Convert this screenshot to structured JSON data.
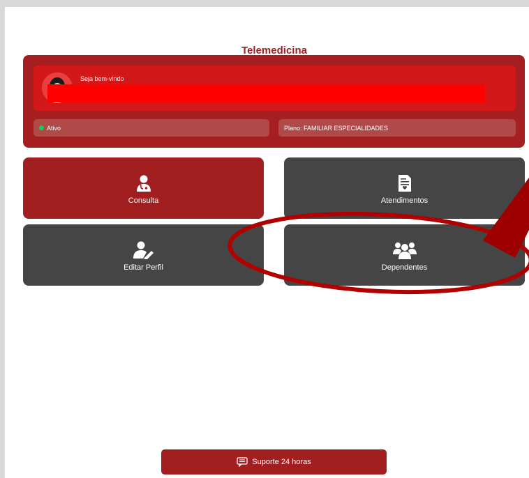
{
  "header": {
    "title": "Telemedicina"
  },
  "welcome": {
    "greeting": "Seja bem-vindo",
    "status": "Ativo",
    "plan": "Plano: FAMILIAR ESPECIALIDADES"
  },
  "tiles": [
    {
      "label": "Consulta",
      "icon": "doctor-icon"
    },
    {
      "label": "Atendimentos",
      "icon": "medical-record-icon"
    },
    {
      "label": "Editar Perfil",
      "icon": "user-edit-icon"
    },
    {
      "label": "Dependentes",
      "icon": "users-group-icon"
    }
  ],
  "support": {
    "label": "Suporte 24 horas",
    "icon": "chat-icon"
  },
  "colors": {
    "brand_red": "#a11f21",
    "dark_tile": "#454545",
    "status_active": "#22c55e",
    "annotation": "#b00000"
  }
}
